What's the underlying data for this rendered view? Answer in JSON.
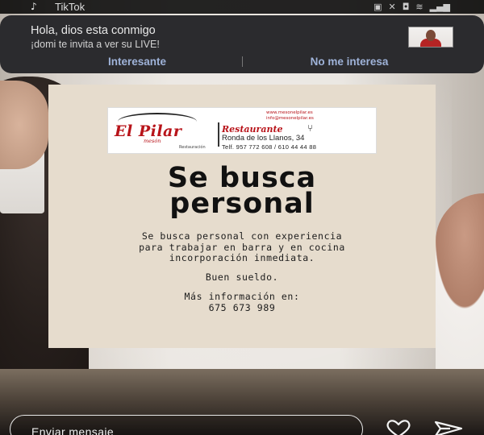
{
  "status_bar": {
    "app_icon": "tiktok-icon",
    "app_name": "TikTok",
    "icons": [
      "notification-icon",
      "mute-icon",
      "alarm-icon",
      "wifi-icon",
      "signal-icon"
    ]
  },
  "notification": {
    "title": "Hola, dios esta conmigo",
    "body": "¡domi te invita a ver su LIVE!",
    "actions": {
      "interesting": "Interesante",
      "not_interested": "No me interesa"
    }
  },
  "post": {
    "logo": {
      "brand": "El Pilar",
      "sub": "mesón",
      "tag": "Restauración",
      "web": "www.mesonelpilar.es",
      "email": "info@mesonelpilar.es",
      "restaurant": "Restaurante",
      "address": "Ronda de los Llanos, 34",
      "phone": "Telf. 957 772 608 / 610 44 44 88"
    },
    "headline_line1": "Se busca",
    "headline_line2": "personal",
    "desc_line1": "Se busca personal con experiencia",
    "desc_line2": "para trabajar en barra y en cocina",
    "desc_line3": "incorporación inmediata.",
    "salary": "Buen sueldo.",
    "more_info_label": "Más información en:",
    "phone": "675 673 989"
  },
  "bottom_bar": {
    "message_placeholder": "Enviar mensaje",
    "like_icon": "heart-icon",
    "share_icon": "send-icon"
  },
  "colors": {
    "card_bg": "#e6dccd",
    "brand_red": "#b8141a",
    "notification_bg": "#2b2b2e",
    "action_text": "#9fb3d9"
  }
}
